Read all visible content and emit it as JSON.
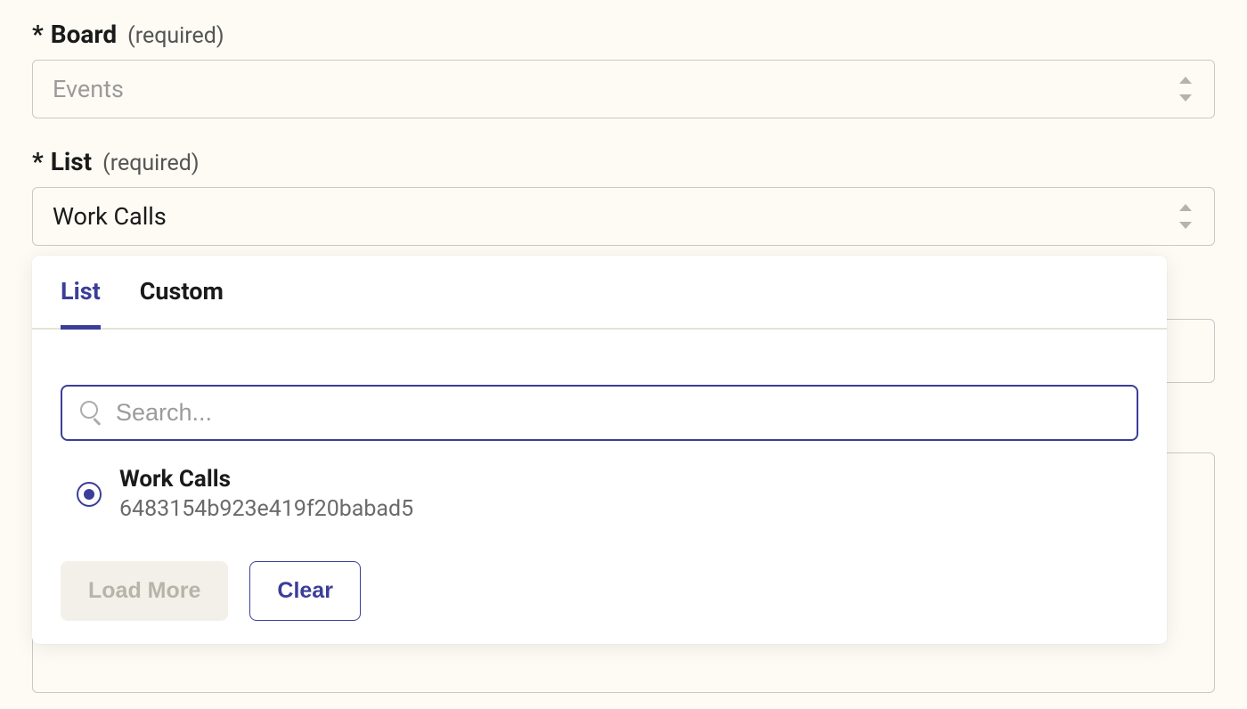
{
  "fields": {
    "board": {
      "asterisk": "*",
      "label": "Board",
      "required_text": "(required)",
      "value": "Events"
    },
    "list": {
      "asterisk": "*",
      "label": "List",
      "required_text": "(required)",
      "value": "Work Calls"
    }
  },
  "dropdown": {
    "tabs": {
      "list": "List",
      "custom": "Custom"
    },
    "search": {
      "placeholder": "Search..."
    },
    "options": [
      {
        "name": "Work Calls",
        "id": "6483154b923e419f20babad5",
        "selected": true
      }
    ],
    "buttons": {
      "load_more": "Load More",
      "clear": "Clear"
    }
  },
  "colors": {
    "accent": "#3b3e99",
    "bg": "#fdfbf4",
    "text": "#1a1a1a",
    "muted": "#6a6a6a"
  }
}
